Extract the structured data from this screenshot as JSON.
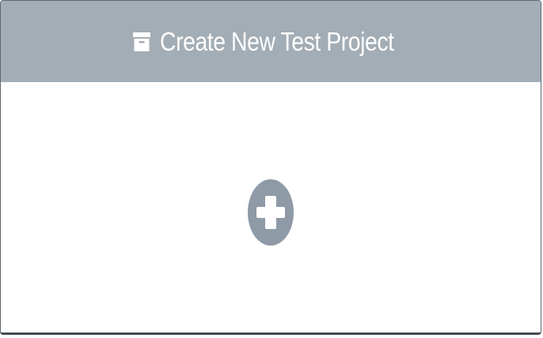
{
  "card": {
    "header": {
      "icon": "archive-icon",
      "title": "Create New Test Project"
    },
    "body": {
      "add_icon": "plus-circle-icon"
    }
  },
  "colors": {
    "header_bg": "#a3adb5",
    "header_text": "#ffffff",
    "add_icon": "#8e9aa6",
    "border": "#5f6670"
  }
}
